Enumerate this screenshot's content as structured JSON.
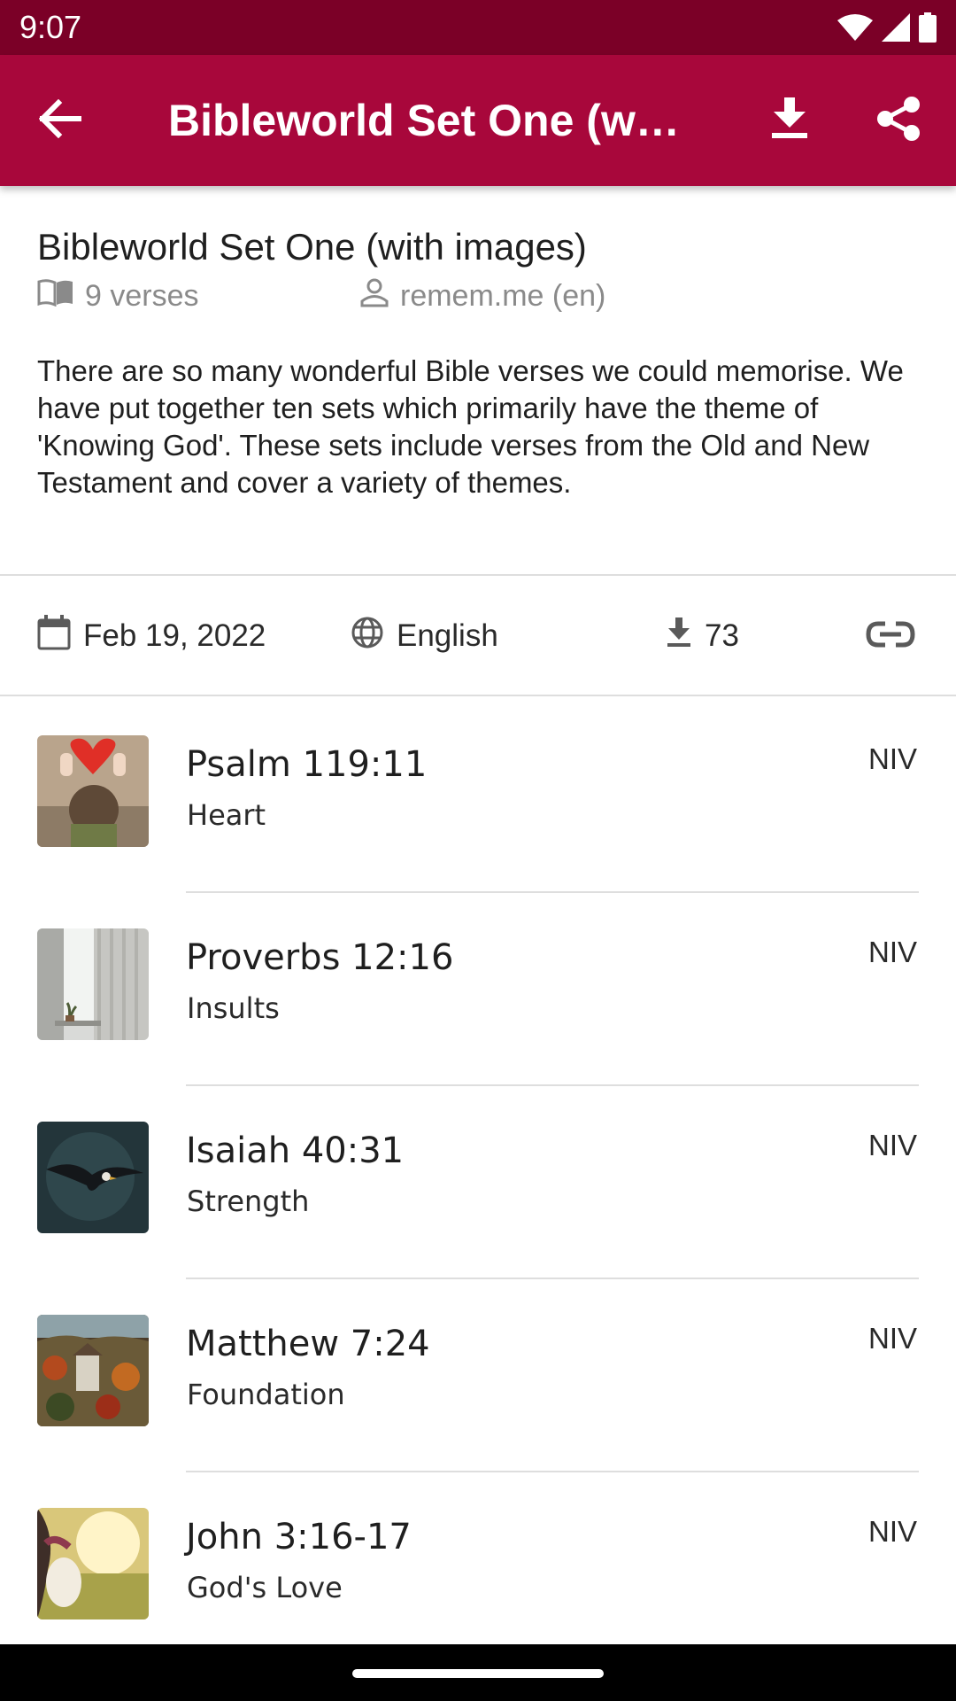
{
  "status_bar": {
    "time": "9:07",
    "icons": [
      "wifi-icon",
      "cell-signal-icon",
      "battery-icon"
    ]
  },
  "app_bar": {
    "title": "Bibleworld Set One (with images)",
    "background": "#a8073b",
    "status_background": "#7b0027"
  },
  "set": {
    "title": "Bibleworld Set One (with images)",
    "verse_count": "9 verses",
    "author": "remem.me (en)",
    "description": "There are so many wonderful Bible verses we could memorise. We have put together ten sets which primarily have the theme of 'Knowing God'. These sets include verses from the Old and New Testament and cover a variety of themes."
  },
  "info": {
    "date": "Feb 19, 2022",
    "language": "English",
    "downloads": "73"
  },
  "verses": [
    {
      "reference": "Psalm 119:11",
      "topic": "Heart",
      "version": "NIV"
    },
    {
      "reference": "Proverbs 12:16",
      "topic": "Insults",
      "version": "NIV"
    },
    {
      "reference": "Isaiah 40:31",
      "topic": "Strength",
      "version": "NIV"
    },
    {
      "reference": "Matthew 7:24",
      "topic": "Foundation",
      "version": "NIV"
    },
    {
      "reference": "John 3:16-17",
      "topic": "God's Love",
      "version": "NIV"
    }
  ]
}
